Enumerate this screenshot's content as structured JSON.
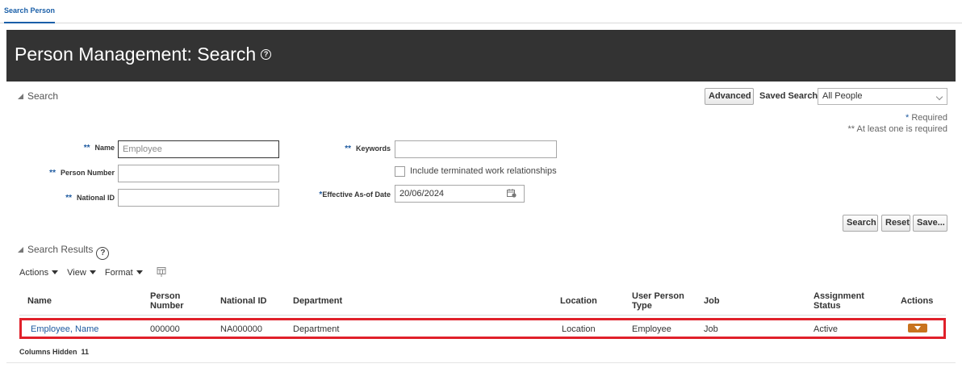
{
  "tab": {
    "label": "Search Person"
  },
  "header": {
    "title": "Person Management: Search",
    "help_glyph": "?"
  },
  "search_section": {
    "title": "Search",
    "advanced_label": "Advanced",
    "saved_search_label": "Saved Search",
    "saved_search_value": "All People",
    "required_note": "Required",
    "required_star": "*",
    "at_least_one_note": "At least one is required",
    "at_least_one_stars": "**",
    "fields": {
      "name": {
        "label": "Name",
        "marker": "**",
        "placeholder": "Employee",
        "value": ""
      },
      "person_number": {
        "label": "Person Number",
        "marker": "**",
        "value": ""
      },
      "national_id": {
        "label": "National ID",
        "marker": "**",
        "value": ""
      },
      "keywords": {
        "label": "Keywords",
        "marker": "**",
        "value": ""
      },
      "include_terminated": {
        "label": "Include terminated work relationships",
        "checked": false
      },
      "effective_date": {
        "label": "Effective As-of Date",
        "marker": "*",
        "value": "20/06/2024"
      }
    },
    "buttons": {
      "search": "Search",
      "reset": "Reset",
      "save": "Save..."
    }
  },
  "results_section": {
    "title": "Search Results",
    "help_glyph": "?",
    "toolbar": {
      "actions": "Actions",
      "view": "View",
      "format": "Format"
    },
    "columns": {
      "name": "Name",
      "person_number": "Person Number",
      "national_id": "National ID",
      "department": "Department",
      "location": "Location",
      "user_person_type": "User Person Type",
      "job": "Job",
      "assignment_status": "Assignment Status",
      "actions": "Actions"
    },
    "rows": [
      {
        "name": "Employee, Name",
        "person_number": "000000",
        "national_id": "NA000000",
        "department": "Department",
        "location": "Location",
        "user_person_type": "Employee",
        "job": "Job",
        "assignment_status": "Active"
      }
    ],
    "columns_hidden_label": "Columns Hidden",
    "columns_hidden_count": "11"
  },
  "colors": {
    "banner": "#333333",
    "link": "#1e5aa0",
    "highlight": "#e0202a",
    "action_button": "#c8731e"
  }
}
